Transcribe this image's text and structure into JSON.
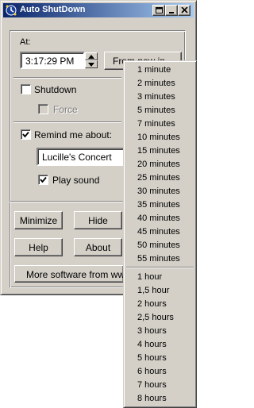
{
  "window": {
    "title": "Auto ShutDown"
  },
  "schedule": {
    "at_label": "At:",
    "time_value": "3:17:29 PM",
    "from_now_button": "From now in..."
  },
  "shutdown": {
    "label": "Shutdown",
    "checked": false,
    "force_label": "Force",
    "force_checked": false,
    "force_disabled": true
  },
  "reminder": {
    "label": "Remind me about:",
    "checked": true,
    "text_value": "Lucille's Concert",
    "play_sound_label": "Play sound",
    "play_sound_checked": true
  },
  "actions": {
    "minimize": "Minimize",
    "hide": "Hide",
    "help": "Help",
    "about": "About",
    "more_software": "More software from www.lis"
  },
  "from_now_menu": {
    "minutes": [
      "1 minute",
      "2 minutes",
      "3 minutes",
      "5 minutes",
      "7 minutes",
      "10 minutes",
      "15 minutes",
      "20 minutes",
      "25 minutes",
      "30 minutes",
      "35 minutes",
      "40 minutes",
      "45 minutes",
      "50 minutes",
      "55 minutes"
    ],
    "hours": [
      "1 hour",
      "1,5 hour",
      "2 hours",
      "2,5 hours",
      "3 hours",
      "4 hours",
      "5 hours",
      "6 hours",
      "7 hours",
      "8 hours"
    ]
  }
}
